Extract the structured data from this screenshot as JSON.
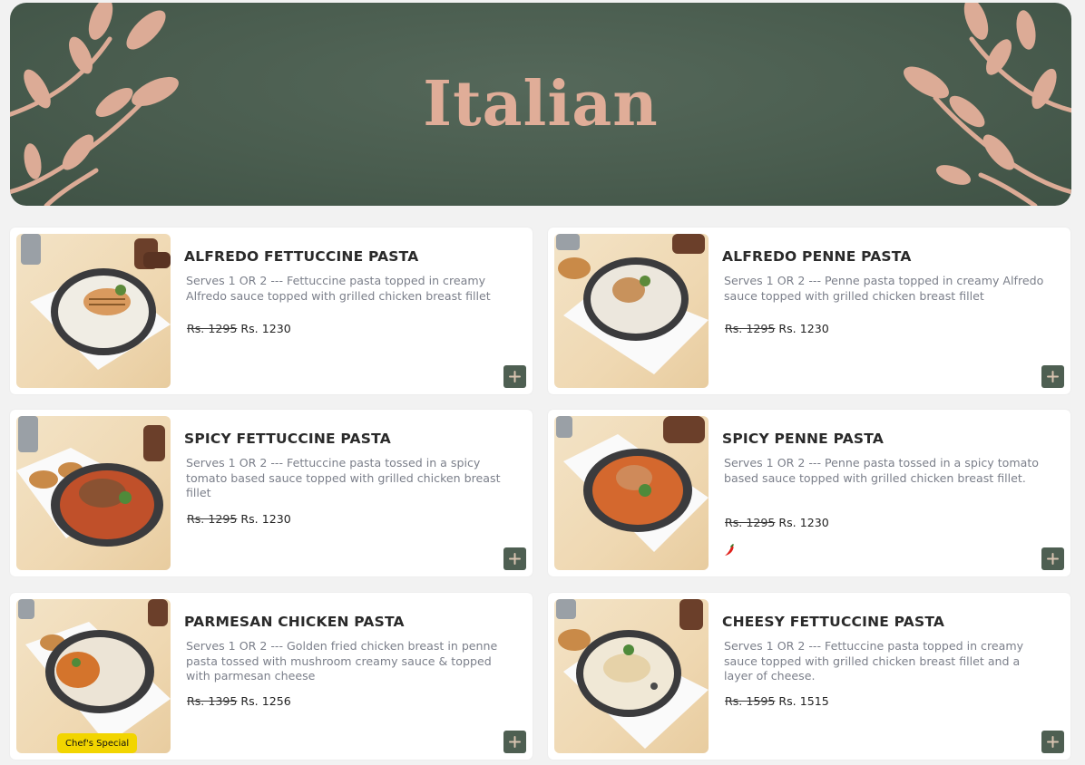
{
  "banner": {
    "title": "Italian"
  },
  "theme": {
    "accent": "#4e5f52",
    "leaf": "#dcab96",
    "badge": "#f2d500",
    "chili": "#e0201a"
  },
  "currency_note": "prices shown before and after discount",
  "items": [
    {
      "title": "ALFREDO FETTUCCINE PASTA",
      "desc": "Serves 1 OR 2 --- Fettuccine pasta topped in creamy Alfredo sauce topped with grilled chicken breast fillet",
      "old_price": "Rs. 1295",
      "price": "Rs. 1230",
      "icon": "plus-icon"
    },
    {
      "title": "ALFREDO PENNE PASTA",
      "desc": "Serves 1 OR 2 --- Penne pasta topped in creamy Alfredo sauce topped with grilled chicken breast fillet",
      "old_price": "Rs. 1295",
      "price": "Rs. 1230",
      "icon": "plus-icon"
    },
    {
      "title": "SPICY FETTUCCINE PASTA",
      "desc": "Serves 1 OR 2 --- Fettuccine pasta tossed in a spicy tomato based sauce topped with grilled chicken breast fillet",
      "old_price": "Rs. 1295",
      "price": "Rs. 1230",
      "icon": "plus-icon"
    },
    {
      "title": "SPICY PENNE PASTA",
      "desc": "Serves 1 OR 2 --- Penne pasta tossed in a spicy tomato based sauce topped with grilled chicken breast fillet.",
      "old_price": "Rs. 1295",
      "price": "Rs. 1230",
      "icon": "plus-icon",
      "tag_icon": "chili-icon"
    },
    {
      "title": "PARMESAN CHICKEN PASTA",
      "desc": "Serves 1 OR 2 --- Golden fried chicken breast in penne pasta tossed with mushroom creamy sauce & topped with parmesan cheese",
      "old_price": "Rs. 1395",
      "price": "Rs. 1256",
      "icon": "plus-icon",
      "badge": "Chef's Special"
    },
    {
      "title": "CHEESY FETTUCCINE PASTA",
      "desc": "Serves 1 OR 2 --- Fettuccine pasta topped in creamy sauce topped with grilled chicken breast fillet and a layer of cheese.",
      "old_price": "Rs. 1595",
      "price": "Rs. 1515",
      "icon": "plus-icon"
    }
  ]
}
